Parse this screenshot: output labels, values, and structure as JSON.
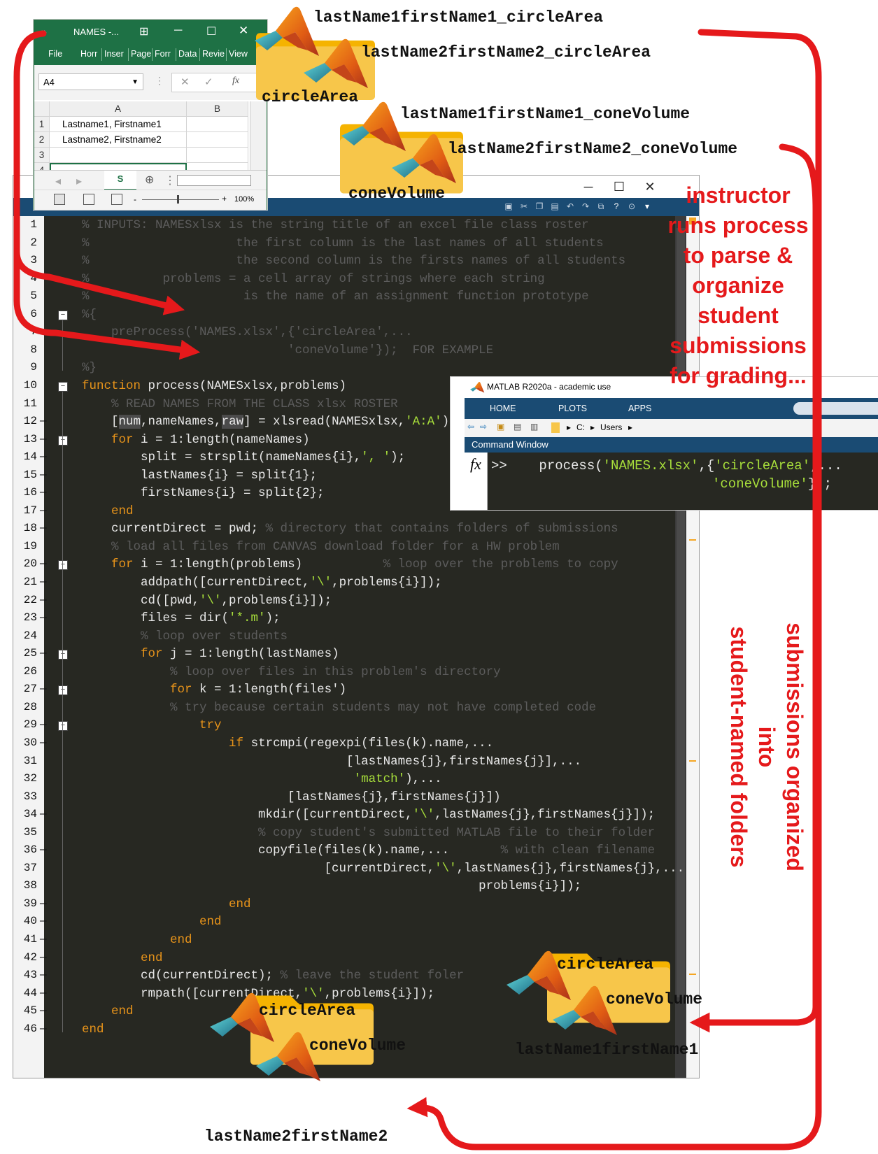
{
  "excel": {
    "title": "NAMES -...",
    "ribbon_tabs": [
      "File",
      "Horr",
      "Inser",
      "Page",
      "Forr",
      "Data",
      "Revie",
      "View"
    ],
    "name_box": "A4",
    "fx_label": "fx",
    "columns": [
      "A",
      "B"
    ],
    "rows": [
      {
        "num": "1",
        "a": "Lastname1, Firstname1"
      },
      {
        "num": "2",
        "a": "Lastname2, Firstname2"
      },
      {
        "num": "3",
        "a": ""
      },
      {
        "num": "4",
        "a": ""
      }
    ],
    "sheet_tab": "S",
    "zoom": "100%"
  },
  "editor": {
    "lines": [
      {
        "n": "1",
        "exec": false
      },
      {
        "n": "2",
        "exec": false
      },
      {
        "n": "3",
        "exec": false
      },
      {
        "n": "4",
        "exec": false
      },
      {
        "n": "5",
        "exec": false
      },
      {
        "n": "6",
        "exec": false
      },
      {
        "n": "7",
        "exec": false
      },
      {
        "n": "8",
        "exec": false
      },
      {
        "n": "9",
        "exec": false
      },
      {
        "n": "10",
        "exec": false
      },
      {
        "n": "11",
        "exec": false
      },
      {
        "n": "12",
        "exec": true
      },
      {
        "n": "13",
        "exec": true
      },
      {
        "n": "14",
        "exec": true
      },
      {
        "n": "15",
        "exec": true
      },
      {
        "n": "16",
        "exec": true
      },
      {
        "n": "17",
        "exec": true
      },
      {
        "n": "18",
        "exec": true
      },
      {
        "n": "19",
        "exec": false
      },
      {
        "n": "20",
        "exec": true
      },
      {
        "n": "21",
        "exec": true
      },
      {
        "n": "22",
        "exec": true
      },
      {
        "n": "23",
        "exec": true
      },
      {
        "n": "24",
        "exec": false
      },
      {
        "n": "25",
        "exec": true
      },
      {
        "n": "26",
        "exec": false
      },
      {
        "n": "27",
        "exec": true
      },
      {
        "n": "28",
        "exec": false
      },
      {
        "n": "29",
        "exec": true
      },
      {
        "n": "30",
        "exec": true
      },
      {
        "n": "31",
        "exec": false
      },
      {
        "n": "32",
        "exec": false
      },
      {
        "n": "33",
        "exec": false
      },
      {
        "n": "34",
        "exec": true
      },
      {
        "n": "35",
        "exec": false
      },
      {
        "n": "36",
        "exec": true
      },
      {
        "n": "37",
        "exec": false
      },
      {
        "n": "38",
        "exec": false
      },
      {
        "n": "39",
        "exec": true
      },
      {
        "n": "40",
        "exec": true
      },
      {
        "n": "41",
        "exec": true
      },
      {
        "n": "42",
        "exec": true
      },
      {
        "n": "43",
        "exec": true
      },
      {
        "n": "44",
        "exec": true
      },
      {
        "n": "45",
        "exec": true
      },
      {
        "n": "46",
        "exec": true
      }
    ],
    "code": [
      [
        {
          "t": "% INPUTS: NAMESxlsx is the string title of an excel file class roster",
          "c": "cm"
        }
      ],
      [
        {
          "t": "%                    the first column is the last names of all students",
          "c": "cm"
        }
      ],
      [
        {
          "t": "%                    the second column is the firsts names of all students",
          "c": "cm"
        }
      ],
      [
        {
          "t": "%          problems = a cell array of strings where each string",
          "c": "cm"
        }
      ],
      [
        {
          "t": "%                     is the name of an assignment function prototype",
          "c": "cm"
        }
      ],
      [
        {
          "t": "%{",
          "c": "cm"
        }
      ],
      [
        {
          "t": "    preProcess('NAMES.xlsx',{'circleArea',...",
          "c": "cm"
        }
      ],
      [
        {
          "t": "                            'coneVolume'});  FOR EXAMPLE",
          "c": "cm"
        }
      ],
      [
        {
          "t": "%}",
          "c": "cm"
        }
      ],
      [
        {
          "t": "function",
          "c": "kw"
        },
        {
          "t": " process(NAMESxlsx,problems)",
          "c": ""
        }
      ],
      [
        {
          "t": "    % READ NAMES FROM THE CLASS xlsx ROSTER",
          "c": "cm"
        }
      ],
      [
        {
          "t": "    [",
          "c": ""
        },
        {
          "t": "num",
          "c": "hl"
        },
        {
          "t": ",nameNames,",
          "c": ""
        },
        {
          "t": "raw",
          "c": "hl"
        },
        {
          "t": "] = xlsread(NAMESxlsx,",
          "c": ""
        },
        {
          "t": "'A:A'",
          "c": "str"
        },
        {
          "t": ");",
          "c": ""
        }
      ],
      [
        {
          "t": "    ",
          "c": ""
        },
        {
          "t": "for",
          "c": "kw"
        },
        {
          "t": " i = 1:length(nameNames)",
          "c": ""
        }
      ],
      [
        {
          "t": "        split = strsplit(nameNames{i},",
          "c": ""
        },
        {
          "t": "', '",
          "c": "str"
        },
        {
          "t": ");",
          "c": ""
        }
      ],
      [
        {
          "t": "        lastNames{i} = split{1};",
          "c": ""
        }
      ],
      [
        {
          "t": "        firstNames{i} = split{2};",
          "c": ""
        }
      ],
      [
        {
          "t": "    ",
          "c": ""
        },
        {
          "t": "end",
          "c": "kw"
        }
      ],
      [
        {
          "t": "    currentDirect = pwd; ",
          "c": ""
        },
        {
          "t": "% directory that contains folders of submissions",
          "c": "cm"
        }
      ],
      [
        {
          "t": "    % load all files from CANVAS download folder for a HW problem",
          "c": "cm"
        }
      ],
      [
        {
          "t": "    ",
          "c": ""
        },
        {
          "t": "for",
          "c": "kw"
        },
        {
          "t": " i = 1:length(problems)           ",
          "c": ""
        },
        {
          "t": "% loop over the problems to copy",
          "c": "cm"
        }
      ],
      [
        {
          "t": "        addpath([currentDirect,",
          "c": ""
        },
        {
          "t": "'\\'",
          "c": "str"
        },
        {
          "t": ",problems{i}]);",
          "c": ""
        }
      ],
      [
        {
          "t": "        cd([pwd,",
          "c": ""
        },
        {
          "t": "'\\'",
          "c": "str"
        },
        {
          "t": ",problems{i}]);",
          "c": ""
        }
      ],
      [
        {
          "t": "        files = dir(",
          "c": ""
        },
        {
          "t": "'*.m'",
          "c": "str"
        },
        {
          "t": ");",
          "c": ""
        }
      ],
      [
        {
          "t": "        % loop over students",
          "c": "cm"
        }
      ],
      [
        {
          "t": "        ",
          "c": ""
        },
        {
          "t": "for",
          "c": "kw"
        },
        {
          "t": " j = 1:length(lastNames)",
          "c": ""
        }
      ],
      [
        {
          "t": "            % loop over files in this problem's directory",
          "c": "cm"
        }
      ],
      [
        {
          "t": "            ",
          "c": ""
        },
        {
          "t": "for",
          "c": "kw"
        },
        {
          "t": " k = 1:length(files')",
          "c": ""
        }
      ],
      [
        {
          "t": "            % try because certain students may not have completed code",
          "c": "cm"
        }
      ],
      [
        {
          "t": "                ",
          "c": ""
        },
        {
          "t": "try",
          "c": "kw"
        }
      ],
      [
        {
          "t": "                    ",
          "c": ""
        },
        {
          "t": "if",
          "c": "kw"
        },
        {
          "t": " strcmpi(regexpi(files(k).name,...",
          "c": ""
        }
      ],
      [
        {
          "t": "                                    [lastNames{j},firstNames{j}],...",
          "c": ""
        }
      ],
      [
        {
          "t": "                                     ",
          "c": ""
        },
        {
          "t": "'match'",
          "c": "str"
        },
        {
          "t": "),...",
          "c": ""
        }
      ],
      [
        {
          "t": "                            [lastNames{j},firstNames{j}])",
          "c": ""
        }
      ],
      [
        {
          "t": "                        mkdir([currentDirect,",
          "c": ""
        },
        {
          "t": "'\\'",
          "c": "str"
        },
        {
          "t": ",lastNames{j},firstNames{j}]);",
          "c": ""
        }
      ],
      [
        {
          "t": "                        % copy student's submitted MATLAB file to their folder",
          "c": "cm"
        }
      ],
      [
        {
          "t": "                        copyfile(files(k).name,...       ",
          "c": ""
        },
        {
          "t": "% with clean filename",
          "c": "cm"
        }
      ],
      [
        {
          "t": "                                 [currentDirect,",
          "c": ""
        },
        {
          "t": "'\\'",
          "c": "str"
        },
        {
          "t": ",lastNames{j},firstNames{j},...",
          "c": ""
        }
      ],
      [
        {
          "t": "                                                      problems{i}]);",
          "c": ""
        }
      ],
      [
        {
          "t": "                    ",
          "c": ""
        },
        {
          "t": "end",
          "c": "kw"
        }
      ],
      [
        {
          "t": "                ",
          "c": ""
        },
        {
          "t": "end",
          "c": "kw"
        }
      ],
      [
        {
          "t": "            ",
          "c": ""
        },
        {
          "t": "end",
          "c": "kw"
        }
      ],
      [
        {
          "t": "        ",
          "c": ""
        },
        {
          "t": "end",
          "c": "kw"
        }
      ],
      [
        {
          "t": "        cd(currentDirect); ",
          "c": ""
        },
        {
          "t": "% leave the student foler",
          "c": "cm"
        }
      ],
      [
        {
          "t": "        rmpath([currentDirect,",
          "c": ""
        },
        {
          "t": "'\\'",
          "c": "str"
        },
        {
          "t": ",problems{i}]);",
          "c": ""
        }
      ],
      [
        {
          "t": "    ",
          "c": ""
        },
        {
          "t": "end",
          "c": "kw"
        }
      ],
      [
        {
          "t": "end",
          "c": "kw"
        }
      ]
    ]
  },
  "matlab": {
    "title": "MATLAB R2020a - academic use",
    "tabs": [
      "HOME",
      "PLOTS",
      "APPS"
    ],
    "path": [
      "C:",
      "Users"
    ],
    "cmd_header": "Command Window",
    "fx": "fx",
    "prompt": ">>",
    "cmd_line1_a": "process(",
    "cmd_line1_b": "'NAMES.xlsx'",
    "cmd_line1_c": ",{",
    "cmd_line1_d": "'circleArea'",
    "cmd_line1_e": ",...",
    "cmd_line2_a": "'coneVolume'",
    "cmd_line2_b": "});"
  },
  "labels": {
    "top_file1": "lastName1firstName1_circleArea",
    "top_file2": "lastName2firstName2_circleArea",
    "top_folder1": "circleArea",
    "top_file3": "lastName1firstName1_coneVolume",
    "top_file4": "lastName2firstName2_coneVolume",
    "top_folder2": "coneVolume",
    "out1_file1": "circleArea",
    "out1_file2": "coneVolume",
    "out1_folder": "lastName1firstName1",
    "out2_file1": "circleArea",
    "out2_file2": "coneVolume",
    "out2_folder": "lastName2firstName2"
  },
  "annotations": {
    "instructor_lines": [
      "instructor",
      "runs process",
      "to parse &",
      "organize",
      "student",
      "submissions",
      "for grading..."
    ],
    "vertical_lines": [
      "submissions organized into",
      "student-named folders"
    ]
  },
  "colors": {
    "arrow": "#e5191b",
    "folder": "#f7c64a",
    "folder_tab": "#f5b301",
    "editor_bg": "#272822",
    "toolbar_blue": "#1a4b73",
    "excel_green": "#1e7145"
  }
}
